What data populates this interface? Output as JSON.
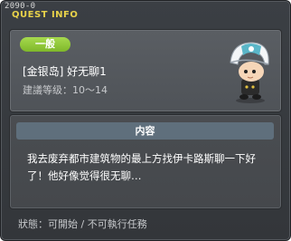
{
  "window": {
    "id_label": "2090-0",
    "title": "QUEST INFO"
  },
  "quest": {
    "category_badge": "一般",
    "name": "[金银岛] 好无聊1",
    "level_range": "建議等级：10～14",
    "character": "helmeted-character-icon"
  },
  "content": {
    "header": "内容",
    "text": "我去废弃都市建筑物的最上方找伊卡路斯聊一下好了！他好像觉得很无聊…"
  },
  "status": {
    "text": "狀態：可開始 / 不可執行任務"
  },
  "colors": {
    "title": "#e8d24a",
    "badge": "#8fc63a",
    "window_bg": "#3b3f44",
    "content_header_bg": "#5f6f7c"
  }
}
